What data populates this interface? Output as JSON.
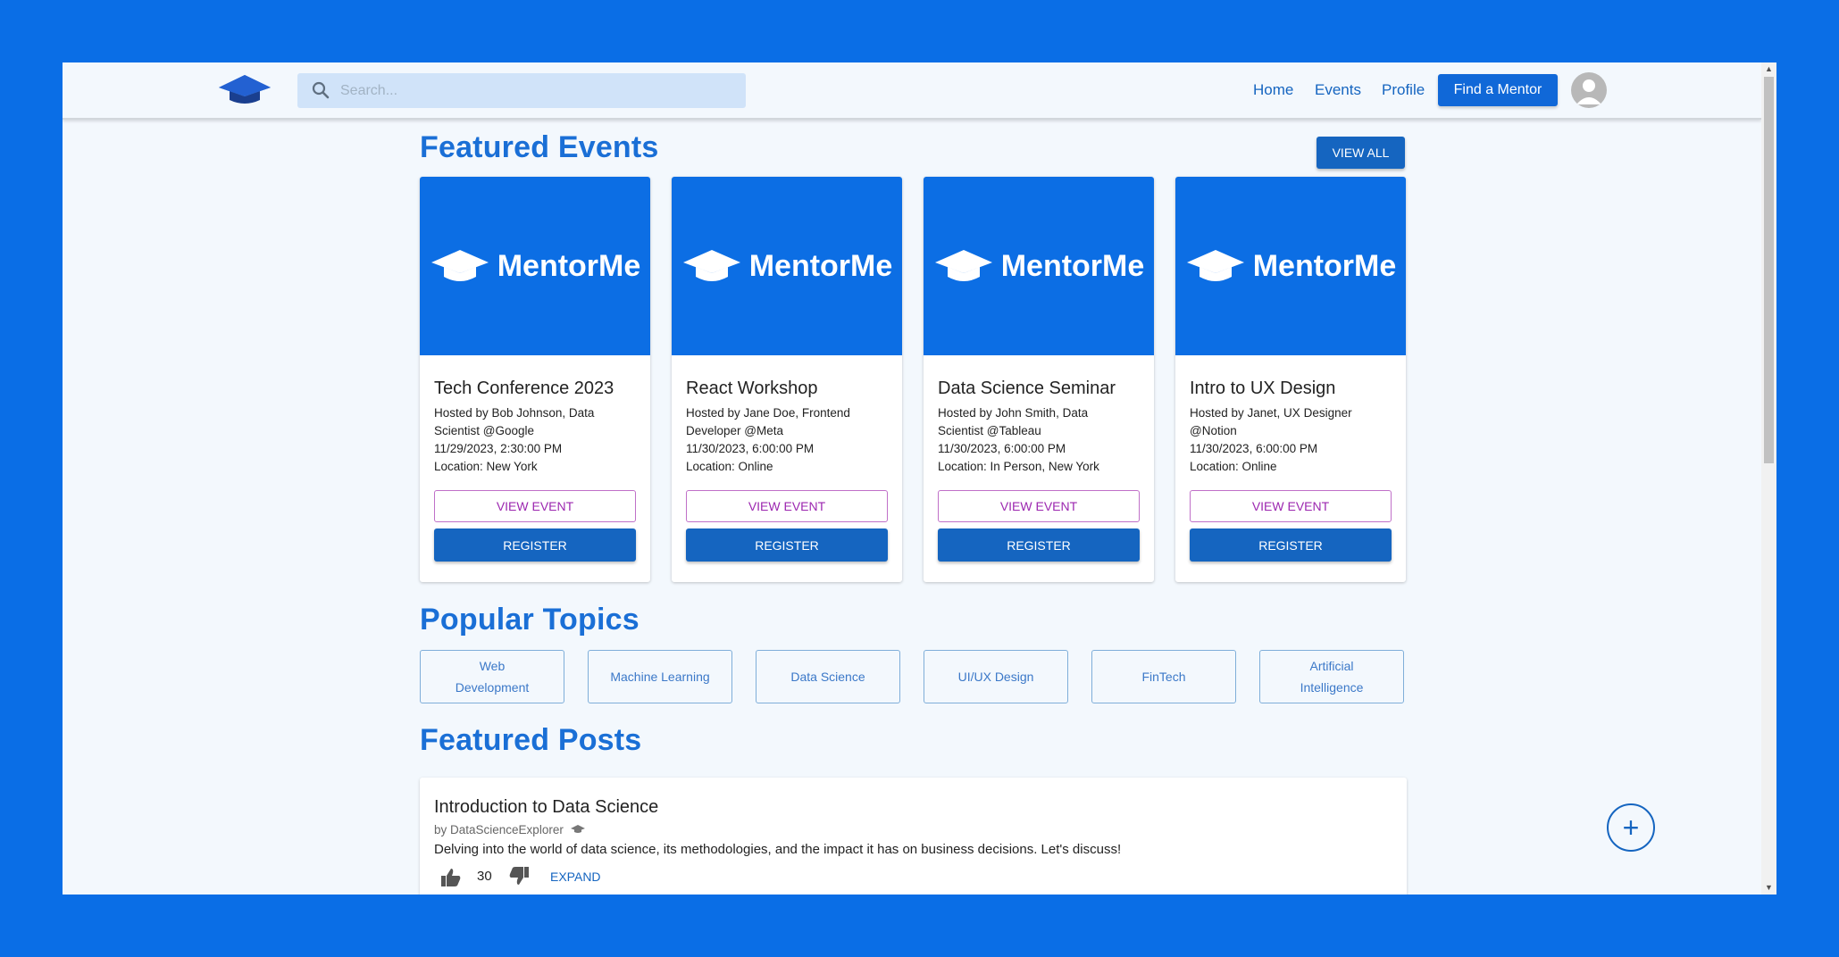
{
  "navbar": {
    "search_placeholder": "Search...",
    "links": [
      "Home",
      "Events",
      "Profile"
    ],
    "find_mentor_label": "Find a Mentor"
  },
  "events": {
    "section_title": "Featured Events",
    "view_all_label": "VIEW ALL",
    "brand_text": "MentorMe",
    "view_event_label": "VIEW EVENT",
    "register_label": "REGISTER",
    "items": [
      {
        "title": "Tech Conference 2023",
        "host_line1": "Hosted by Bob Johnson, Data",
        "host_line2": "Scientist @Google",
        "datetime": "11/29/2023, 2:30:00 PM",
        "location": "Location: New York"
      },
      {
        "title": "React Workshop",
        "host_line1": "Hosted by Jane Doe, Frontend",
        "host_line2": "Developer @Meta",
        "datetime": "11/30/2023, 6:00:00 PM",
        "location": "Location: Online"
      },
      {
        "title": "Data Science Seminar",
        "host_line1": "Hosted by John Smith, Data",
        "host_line2": "Scientist @Tableau",
        "datetime": "11/30/2023, 6:00:00 PM",
        "location": "Location: In Person, New York"
      },
      {
        "title": "Intro to UX Design",
        "host_line1": "Hosted by Janet, UX Designer",
        "host_line2": "@Notion",
        "datetime": "11/30/2023, 6:00:00 PM",
        "location": "Location: Online"
      }
    ]
  },
  "topics": {
    "section_title": "Popular Topics",
    "items": [
      "Web Development",
      "Machine Learning",
      "Data Science",
      "UI/UX Design",
      "FinTech",
      "Artificial Intelligence"
    ]
  },
  "posts": {
    "section_title": "Featured Posts",
    "items": [
      {
        "title": "Introduction to Data Science",
        "author": "by DataScienceExplorer",
        "body": "Delving into the world of data science, its methodologies, and the impact it has on business decisions. Let's discuss!",
        "likes": "30",
        "expand_label": "EXPAND"
      }
    ]
  },
  "fab_label": "+",
  "colors": {
    "accent": "#1565c0",
    "brand_blue": "#0c6ee4",
    "background": "#f3f8fd",
    "outer": "#0a6ee6"
  }
}
